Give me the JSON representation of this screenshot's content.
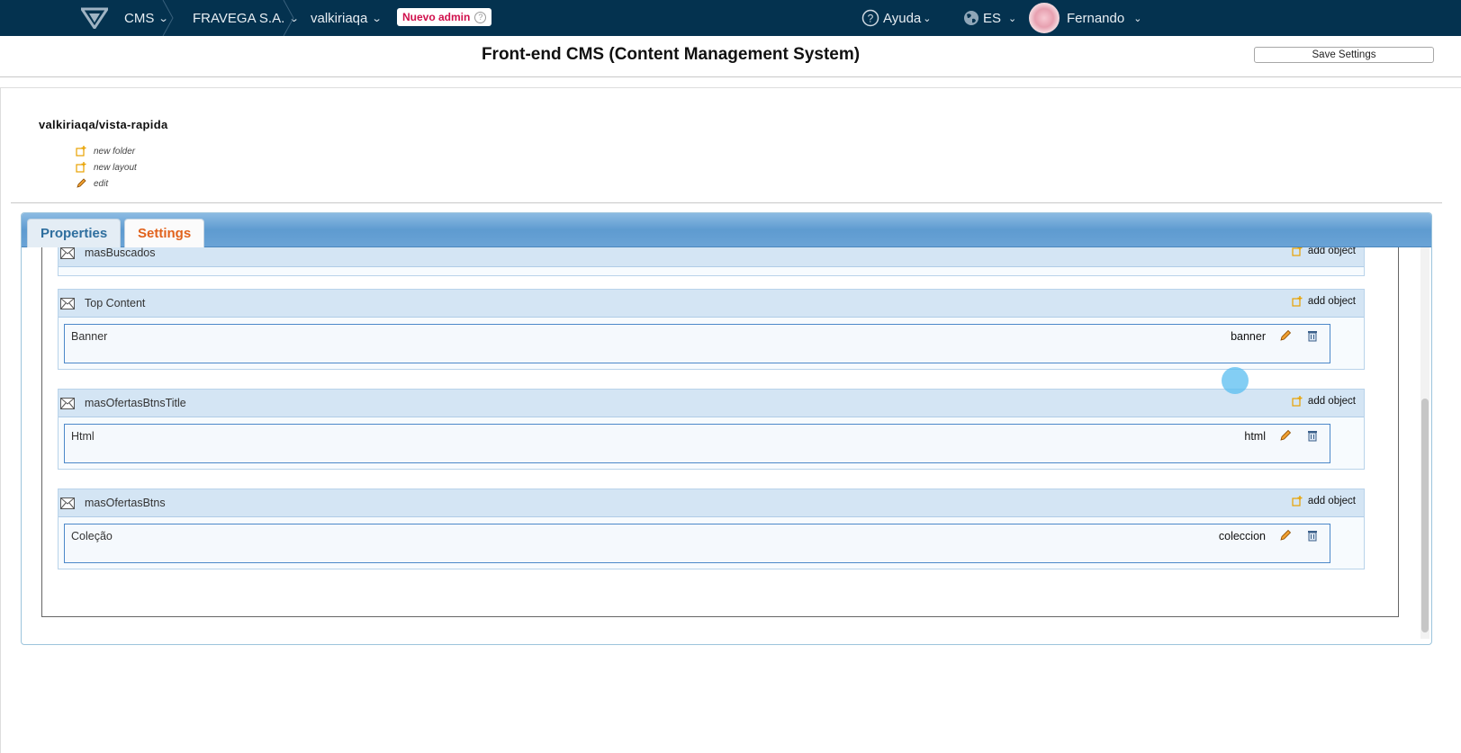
{
  "nav": {
    "cms_label": "CMS",
    "company_label": "FRAVEGA S.A.",
    "store_label": "valkiriaqa",
    "badge_label": "Nuevo admin",
    "help_label": "Ayuda",
    "lang_label": "ES",
    "user_label": "Fernando"
  },
  "header": {
    "title": "Front-end CMS (Content Management System)",
    "save_label": "Save Settings"
  },
  "folder": {
    "path": "valkiriaqa/vista-rapida",
    "actions": [
      "new folder",
      "new layout",
      "edit"
    ]
  },
  "tabs": [
    {
      "label": "Properties"
    },
    {
      "label": "Settings"
    }
  ],
  "sections": [
    {
      "name": "masBuscados",
      "add_label": "add object",
      "items": []
    },
    {
      "name": "Top Content",
      "add_label": "add object",
      "items": [
        {
          "name": "Banner",
          "type": "banner"
        }
      ]
    },
    {
      "name": "masOfertasBtnsTitle",
      "add_label": "add object",
      "items": [
        {
          "name": "Html",
          "type": "html"
        }
      ]
    },
    {
      "name": "masOfertasBtns",
      "add_label": "add object",
      "items": [
        {
          "name": "Coleção",
          "type": "coleccion"
        }
      ]
    }
  ],
  "colors": {
    "nav_bg": "#04324f",
    "badge_text": "#d0104c",
    "settings_tab": "#e1621c",
    "properties_tab": "#2e6e9e",
    "section_head": "#d4e5f4"
  },
  "icons": [
    "logo-icon",
    "help-icon",
    "globe-icon",
    "chevron-down-icon",
    "add-icon",
    "pencil-icon",
    "trash-icon",
    "envelope-icon"
  ]
}
